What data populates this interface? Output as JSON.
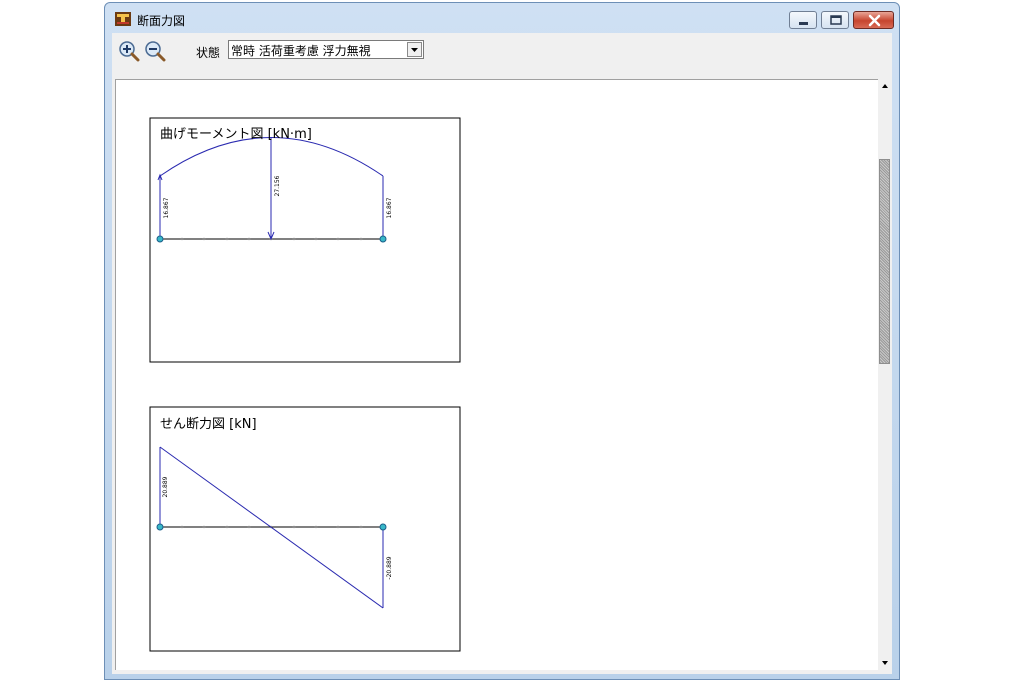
{
  "window": {
    "title": "断面力図",
    "app_icon": "cross-section-app-icon",
    "buttons": {
      "minimize": "minimize-icon",
      "maximize": "maximize-icon",
      "close": "close-icon"
    }
  },
  "toolbar": {
    "zoom_in_icon": "zoom-in-icon",
    "zoom_out_icon": "zoom-out-icon",
    "state_label": "状態",
    "state_value": "常時 活荷重考慮 浮力無視"
  },
  "moment_panel": {
    "title": "曲げモーメント図 [kN·m]",
    "end_left_label": "16.867",
    "mid_label": "27.156",
    "end_right_label": "16.867"
  },
  "shear_panel": {
    "title": "せん断力図 [kN]",
    "start_label": "20.889",
    "end_label": "-20.889"
  },
  "colors": {
    "diagram_line": "#2a2ab0",
    "support_node": "#38b8c8",
    "title_bar": "#c4d8ee"
  }
}
